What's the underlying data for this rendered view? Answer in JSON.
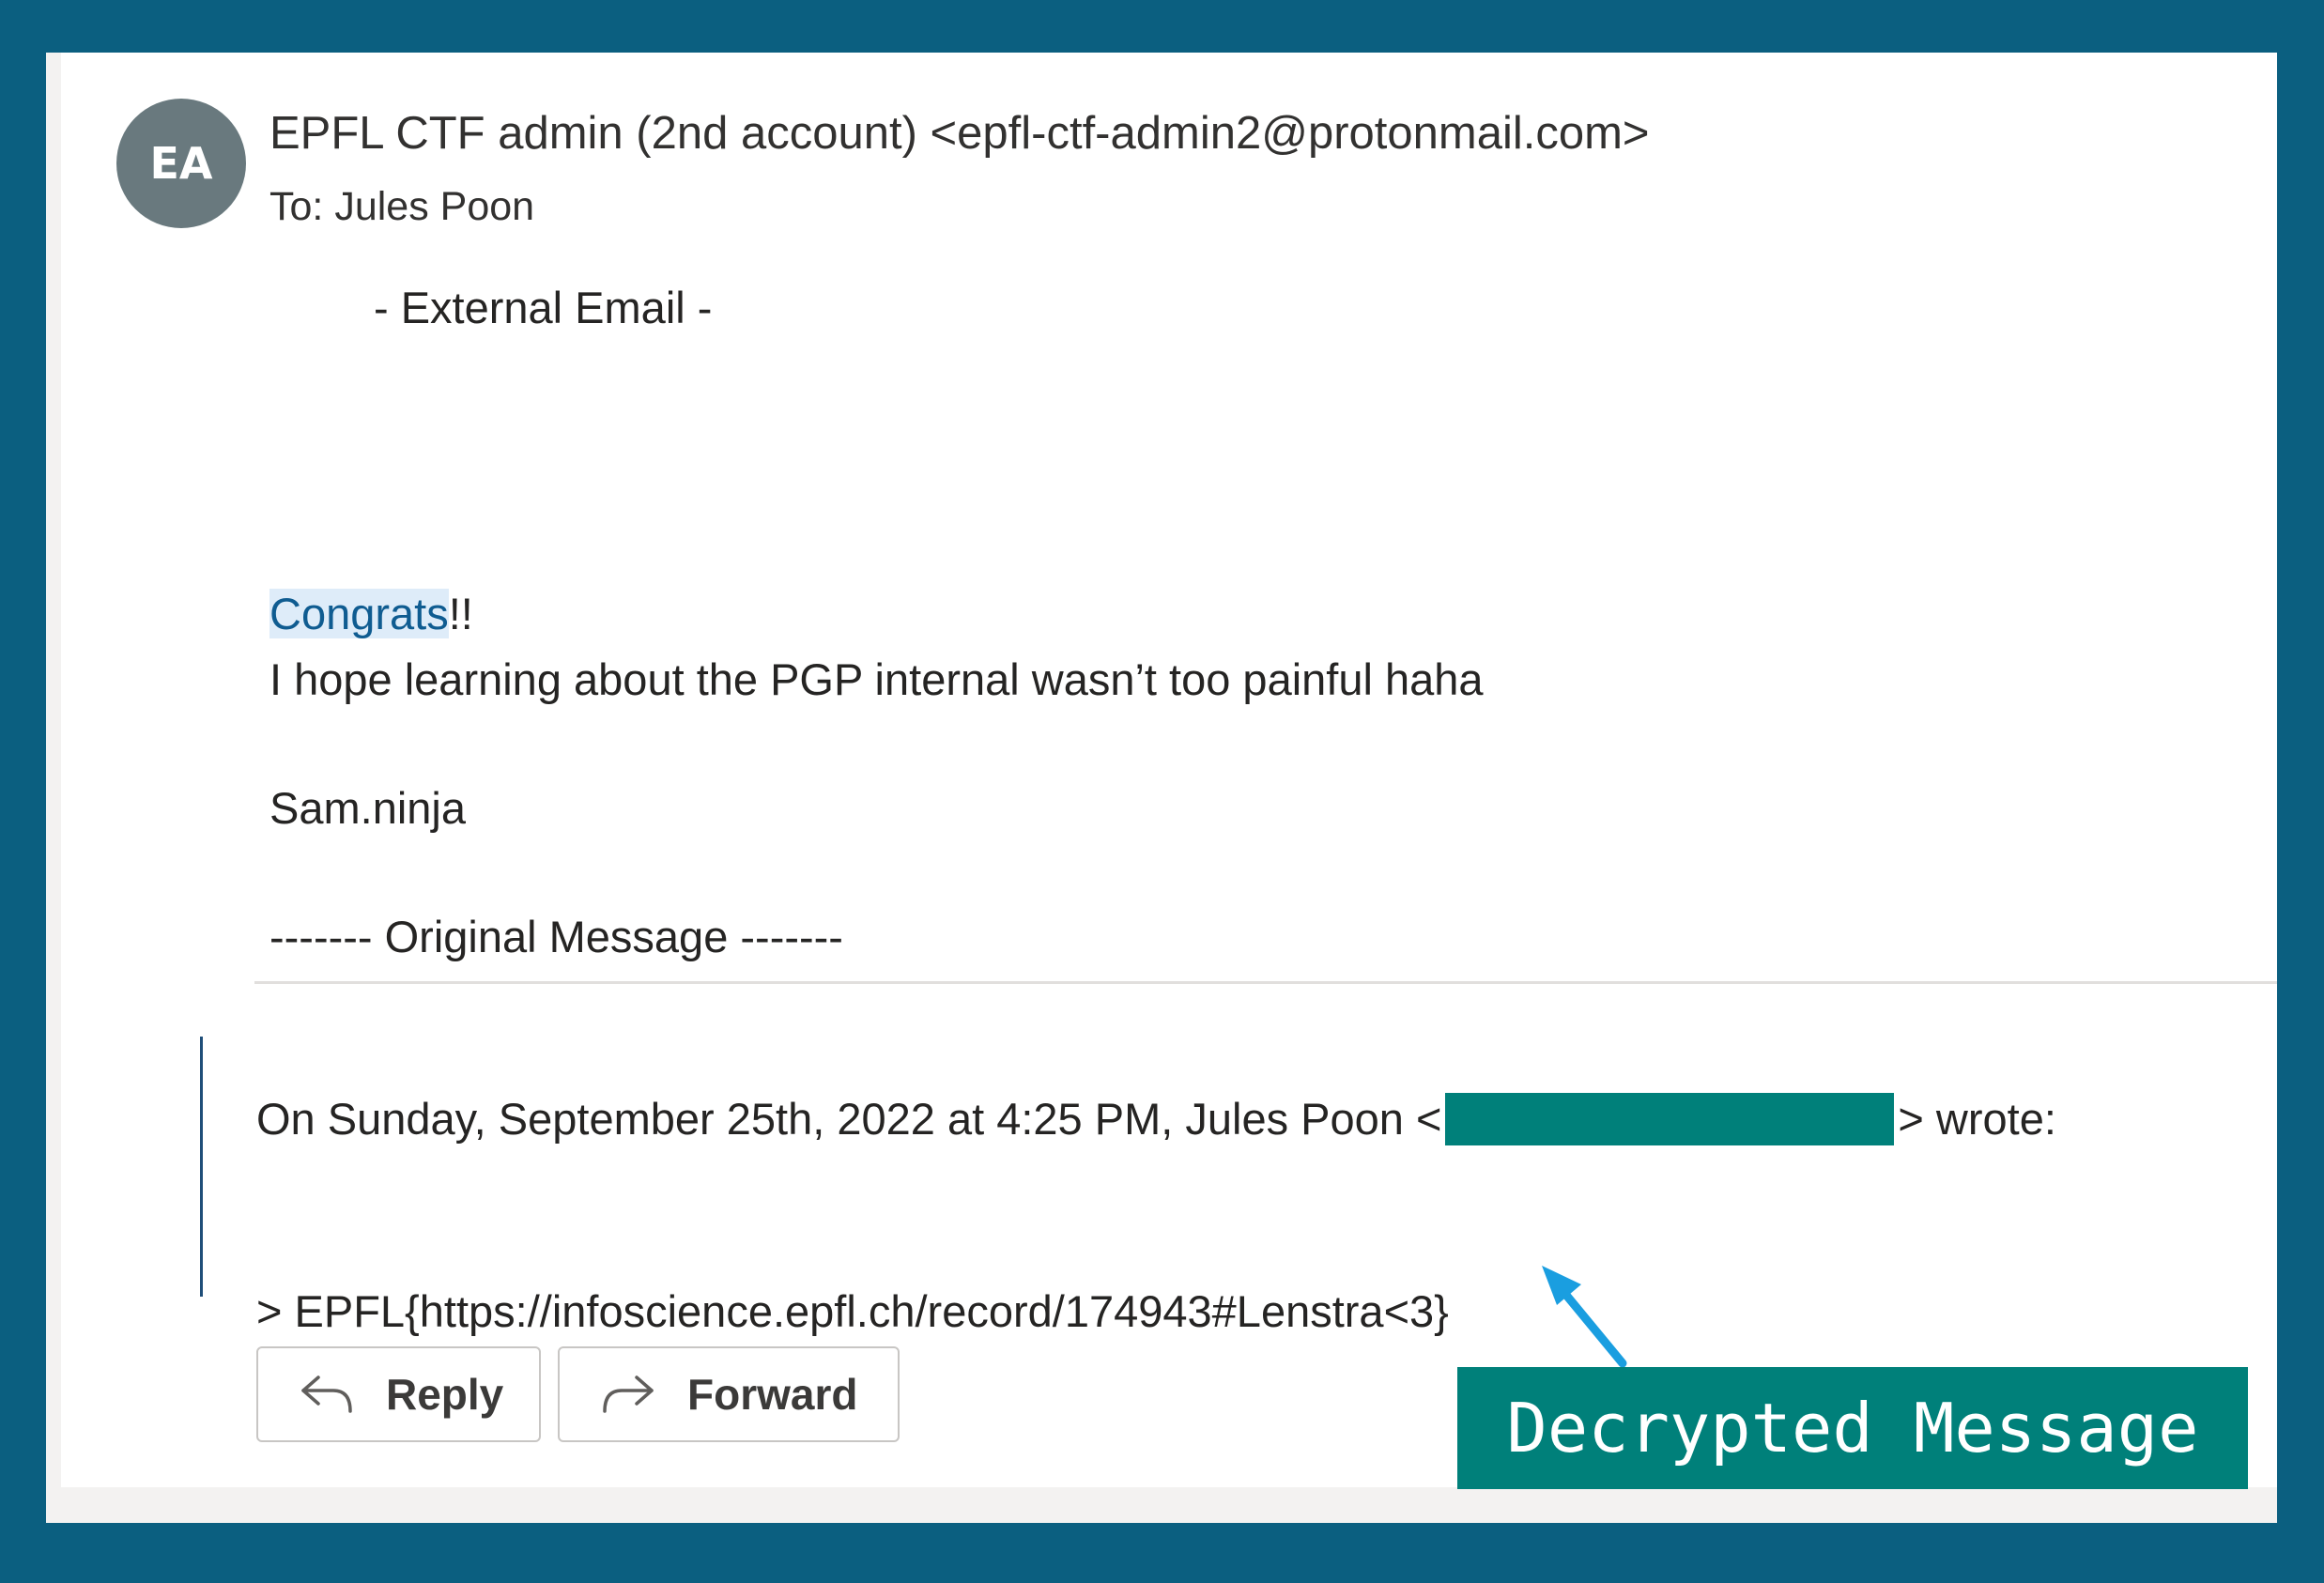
{
  "sender": {
    "initials": "EA",
    "from": "EPFL CTF admin (2nd account) <epfl-ctf-admin2@protonmail.com>",
    "to_label": "To:",
    "to_name": "Jules Poon"
  },
  "body": {
    "external_banner": "- External Email -",
    "congrats_highlight": "Congrats",
    "congrats_rest": "!!",
    "line2": "I hope learning about the PGP internal wasn’t too painful haha",
    "signature": "Sam.ninja",
    "original_header": "------- Original Message -------"
  },
  "quote": {
    "prefix": "On Sunday, September 25th, 2022 at 4:25 PM, Jules Poon <",
    "suffix": "> wrote:",
    "flag_line": "> EPFL{https://infoscience.epfl.ch/record/174943#Lenstra<3}"
  },
  "actions": {
    "reply_label": "Reply",
    "forward_label": "Forward"
  },
  "annotation": {
    "callout_text": "Decrypted Message",
    "callout_color": "#00807a",
    "arrow_color": "#1a9ee0",
    "frame_color": "#0b5f80",
    "highlight_color": "#deecf9"
  }
}
